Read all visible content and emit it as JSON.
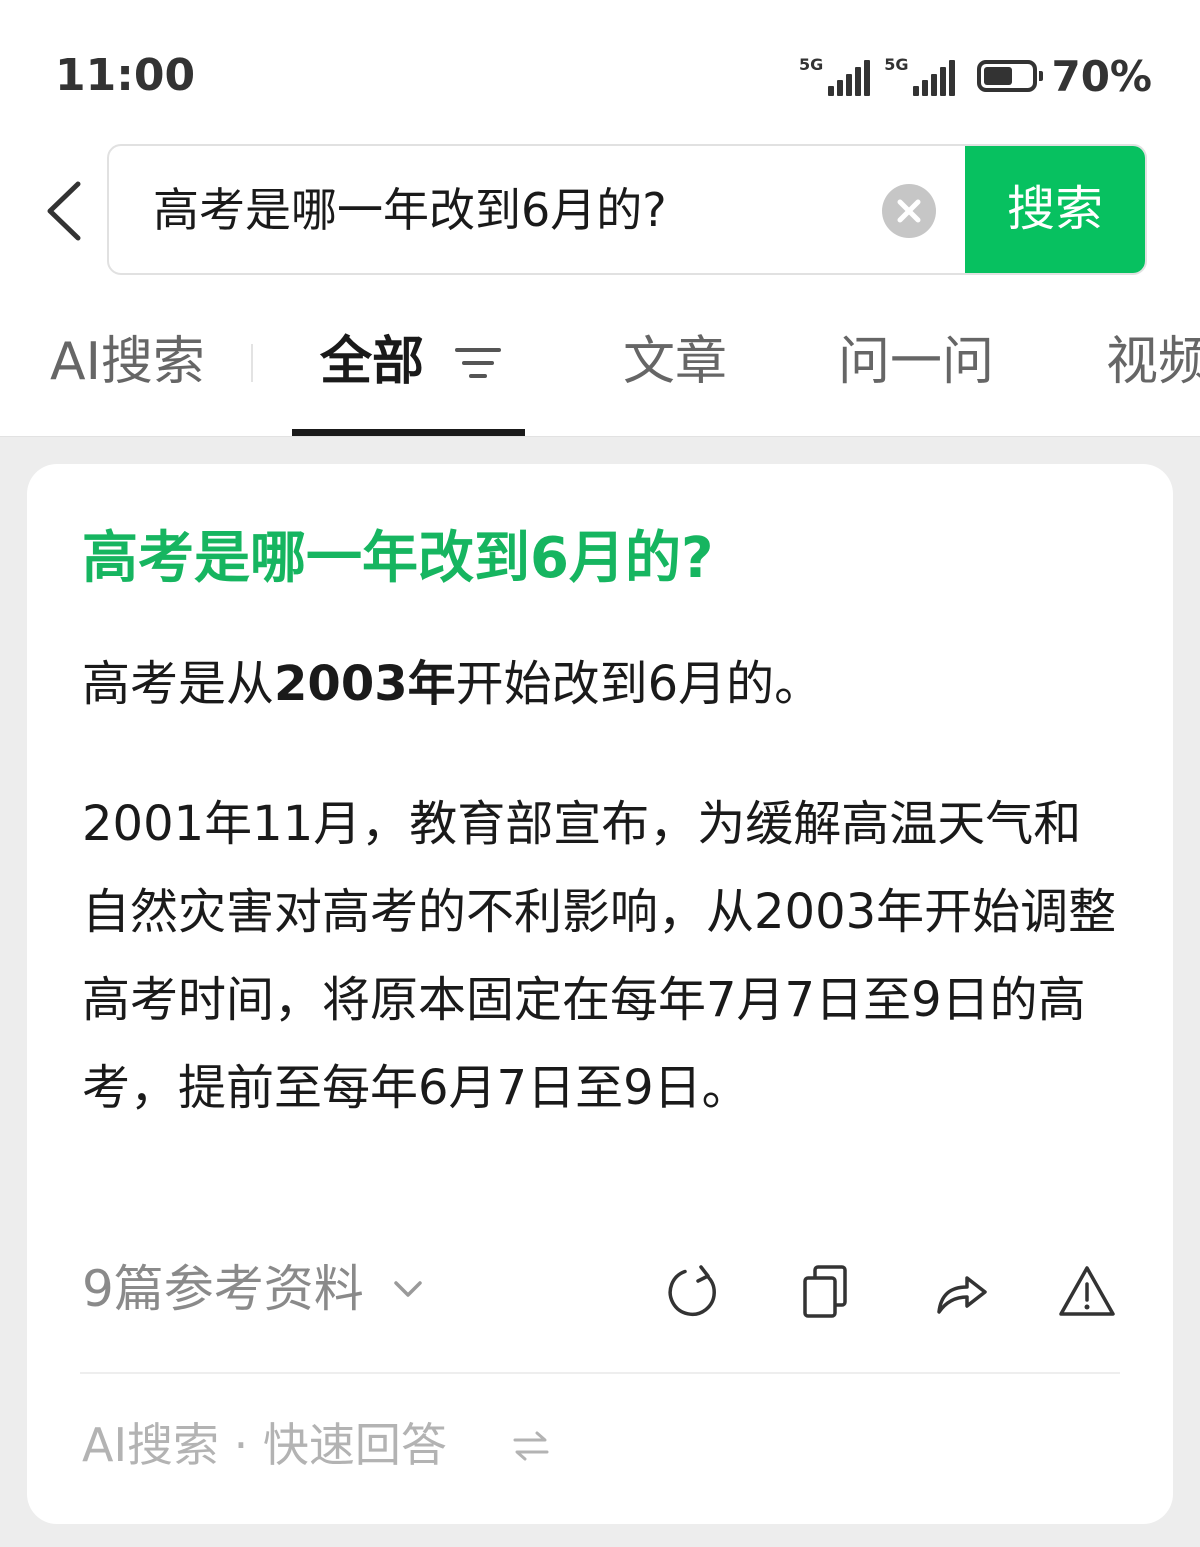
{
  "status_bar": {
    "time": "11:00",
    "net1": "5G",
    "net2": "5G",
    "battery_pct": "70%",
    "battery_level": 0.7
  },
  "search": {
    "query": "高考是哪一年改到6月的?",
    "button_label": "搜索"
  },
  "tabs": [
    {
      "label": "AI搜索"
    },
    {
      "label": "全部"
    },
    {
      "label": "文章"
    },
    {
      "label": "问一问"
    },
    {
      "label": "视频"
    }
  ],
  "result": {
    "title": "高考是哪一年改到6月的?",
    "lead_prefix": "高考是从",
    "lead_bold": "2003年",
    "lead_suffix": "开始改到6月的。",
    "body": "2001年11月，教育部宣布，为缓解高温天气和自然灾害对高考的不利影响，从2003年开始调整高考时间，将原本固定在每年7月7日至9日的高考，提前至每年6月7日至9日。",
    "refs_label": "9篇参考资料",
    "footer": "AI搜索 · 快速回答"
  },
  "colors": {
    "accent": "#07c160",
    "title": "#16b560"
  },
  "icons": [
    "back-icon",
    "clear-icon",
    "filter-icon",
    "chevron-down-icon",
    "refresh-icon",
    "copy-icon",
    "share-icon",
    "warning-icon",
    "switch-icon"
  ]
}
